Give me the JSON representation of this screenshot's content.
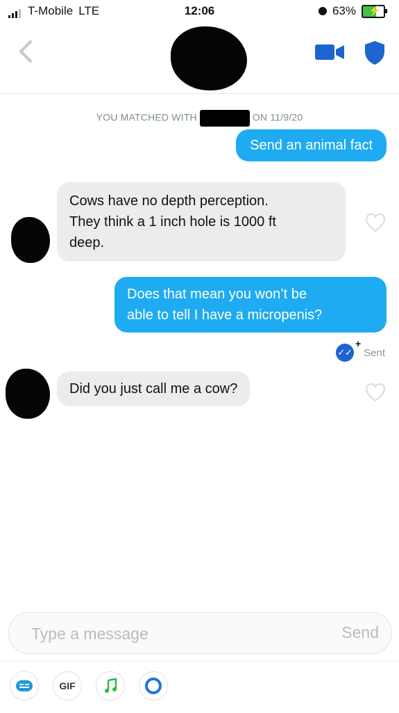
{
  "status": {
    "carrier": "T-Mobile",
    "network": "LTE",
    "time": "12:06",
    "battery": "63%"
  },
  "match": {
    "prefix": "YOU MATCHED WITH",
    "suffix": "ON 11/9/20"
  },
  "messages": [
    {
      "from": "me",
      "text": "Send an animal fact"
    },
    {
      "from": "them",
      "lines": [
        "Cows have no depth perception.",
        "They think a 1 inch hole is 1000 ft",
        "deep."
      ]
    },
    {
      "from": "me",
      "lines": [
        "Does that mean you won’t be",
        "able to tell I have a micropenis?"
      ]
    },
    {
      "from": "them",
      "text": "Did you just call me a cow?"
    }
  ],
  "delivery": {
    "label": "Sent"
  },
  "composer": {
    "placeholder": "Type a message",
    "send_label": "Send"
  },
  "toolbar": {
    "gif_label": "GIF"
  },
  "colors": {
    "sent_bubble": "#1eabf1",
    "received_bubble": "#ececee",
    "accent": "#1e64d0"
  }
}
